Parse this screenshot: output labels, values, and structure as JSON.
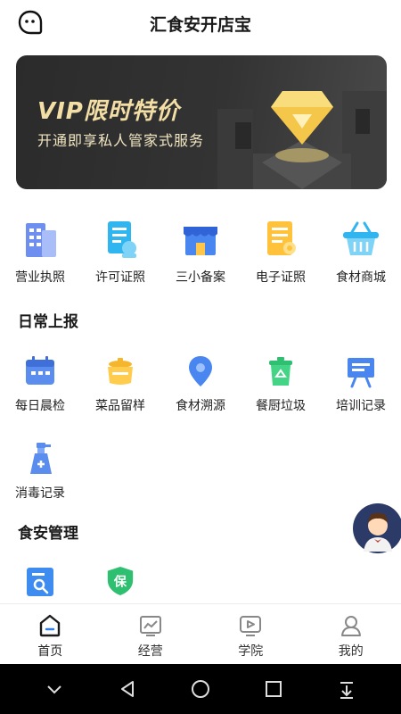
{
  "header": {
    "title": "汇食安开店宝"
  },
  "banner": {
    "title": "VIP限时特价",
    "subtitle": "开通即享私人管家式服务"
  },
  "main_grid": [
    {
      "label": "营业执照",
      "icon": "building-icon"
    },
    {
      "label": "许可证照",
      "icon": "permit-icon"
    },
    {
      "label": "三小备案",
      "icon": "store-icon"
    },
    {
      "label": "电子证照",
      "icon": "certificate-icon"
    },
    {
      "label": "食材商城",
      "icon": "basket-icon"
    }
  ],
  "daily": {
    "title": "日常上报",
    "items": [
      {
        "label": "每日晨检",
        "icon": "calendar-icon"
      },
      {
        "label": "菜品留样",
        "icon": "pot-icon"
      },
      {
        "label": "食材溯源",
        "icon": "location-icon"
      },
      {
        "label": "餐厨垃圾",
        "icon": "recycle-bin-icon"
      },
      {
        "label": "培训记录",
        "icon": "board-icon"
      },
      {
        "label": "消毒记录",
        "icon": "spray-icon"
      }
    ]
  },
  "safety": {
    "title": "食安管理",
    "items": [
      {
        "icon": "search-doc-icon"
      },
      {
        "icon": "shield-icon",
        "badge": "保"
      }
    ]
  },
  "tabs": [
    {
      "label": "首页",
      "icon": "home-icon",
      "active": true
    },
    {
      "label": "经营",
      "icon": "chart-icon"
    },
    {
      "label": "学院",
      "icon": "video-icon"
    },
    {
      "label": "我的",
      "icon": "user-icon"
    }
  ],
  "colors": {
    "accent": "#2f80ed",
    "banner_gold": "#f3dfa5",
    "banner_bg": "#2f2f2f"
  }
}
